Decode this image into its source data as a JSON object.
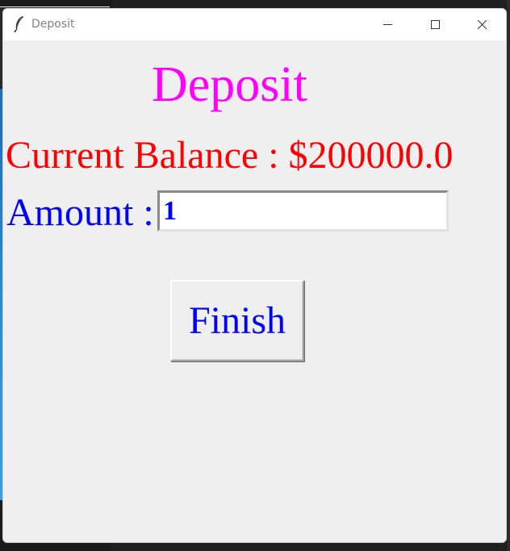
{
  "window": {
    "title": "Deposit"
  },
  "titlebar": {
    "icon": "feather-icon",
    "buttons": [
      "minimize-icon",
      "maximize-icon",
      "close-icon"
    ]
  },
  "main": {
    "heading": "Deposit",
    "balance_text": "Current Balance : $200000.0",
    "amount_label": "Amount :",
    "amount_value": "1",
    "finish_label": "Finish"
  },
  "colors": {
    "heading": "#ff00ff",
    "balance": "#ff0000",
    "amount": "#0000ff",
    "window_bg": "#efefef"
  }
}
